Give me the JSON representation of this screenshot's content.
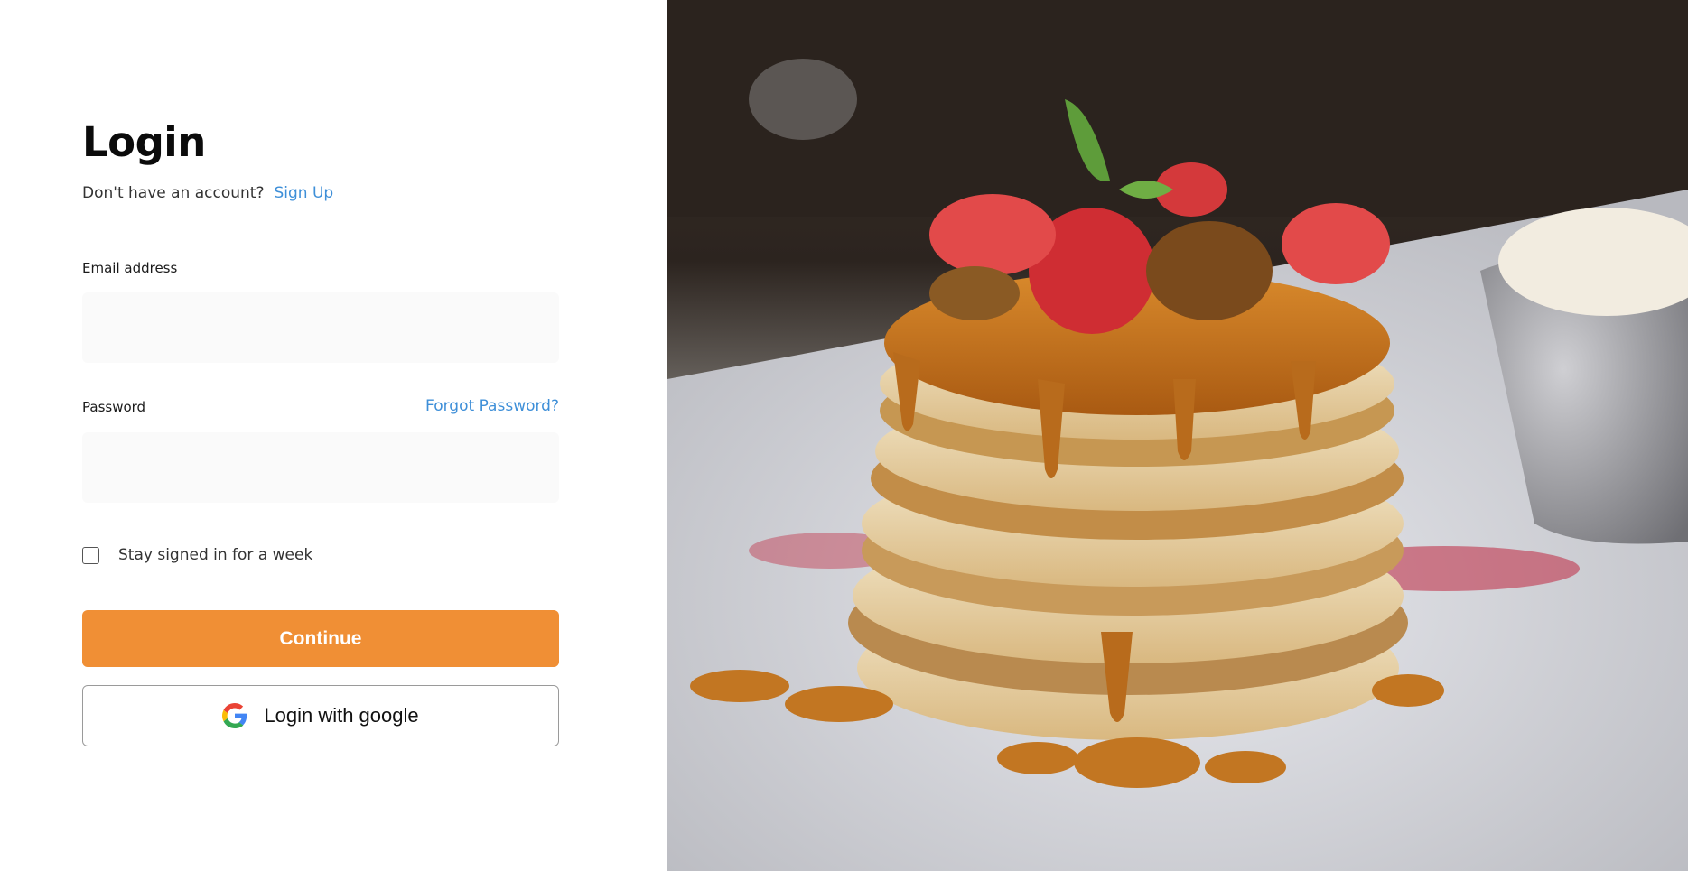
{
  "login": {
    "title": "Login",
    "no_account_text": "Don't have an account?",
    "signup_link": "Sign Up",
    "email_label": "Email address",
    "email_value": "",
    "email_placeholder": "",
    "password_label": "Password",
    "password_value": "",
    "password_placeholder": "",
    "forgot_link": "Forgot Password?",
    "stay_signed_in_label": "Stay signed in for a week",
    "stay_signed_in_checked": false,
    "continue_label": "Continue",
    "google_label": "Login with google"
  },
  "colors": {
    "accent": "#f08f35",
    "link": "#3e8fd8",
    "input_bg": "#fafafa"
  },
  "icons": {
    "google": "google-g-icon"
  },
  "hero_image": {
    "subject": "pancake-stack-with-caramel-and-strawberries"
  }
}
